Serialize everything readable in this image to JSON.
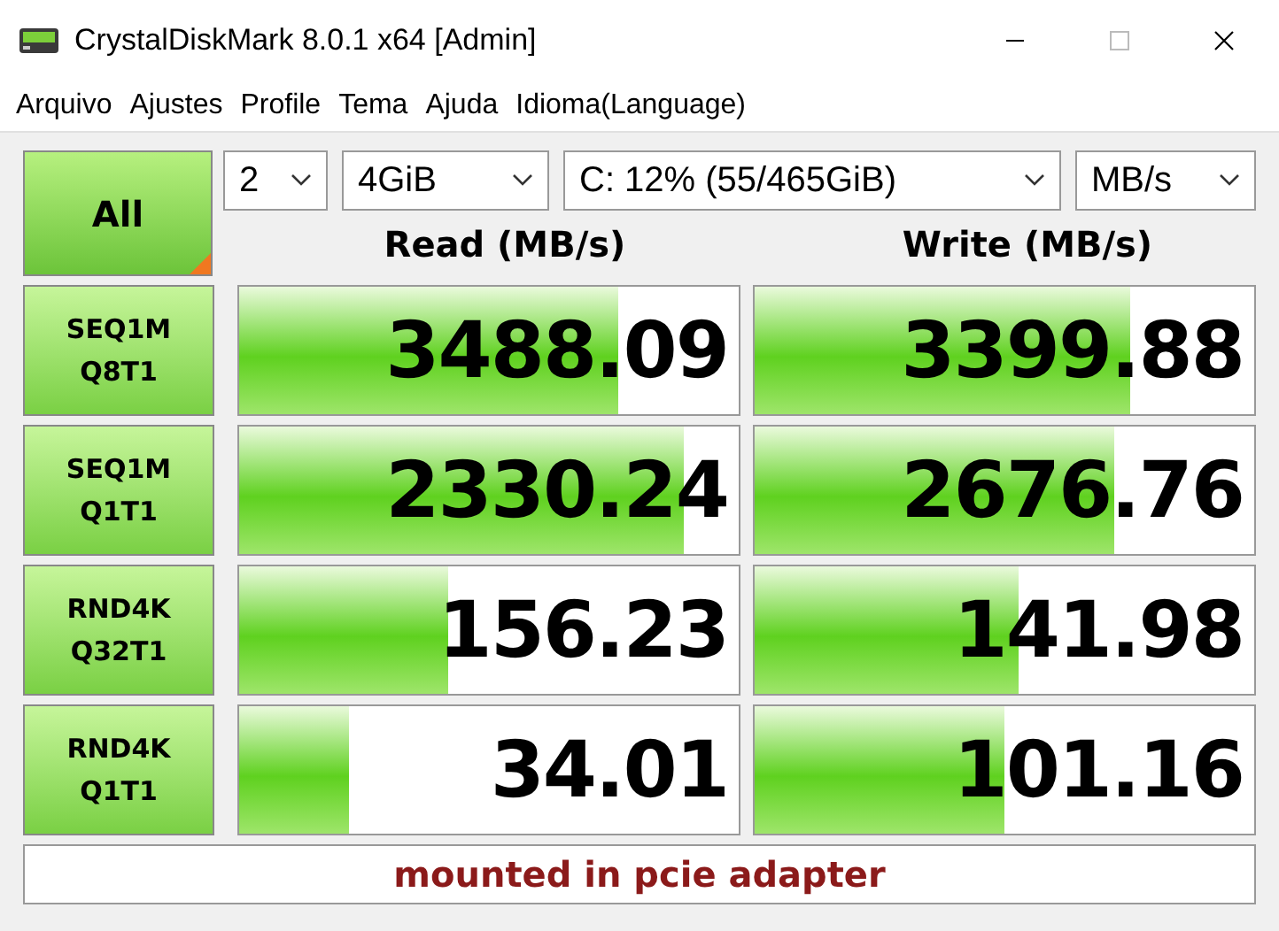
{
  "window": {
    "title": "CrystalDiskMark 8.0.1 x64 [Admin]"
  },
  "menu": [
    "Arquivo",
    "Ajustes",
    "Profile",
    "Tema",
    "Ajuda",
    "Idioma(Language)"
  ],
  "all_button": "All",
  "selectors": [
    {
      "value": "2"
    },
    {
      "value": "4GiB"
    },
    {
      "value": "C: 12% (55/465GiB)"
    },
    {
      "value": "MB/s"
    }
  ],
  "headers": {
    "read": "Read (MB/s)",
    "write": "Write (MB/s)"
  },
  "rows": [
    {
      "test": "SEQ1M",
      "params": "Q8T1",
      "read": {
        "value": "3488.09",
        "level": 0.76
      },
      "write": {
        "value": "3399.88",
        "level": 0.75
      }
    },
    {
      "test": "SEQ1M",
      "params": "Q1T1",
      "read": {
        "value": "2330.24",
        "level": 0.89
      },
      "write": {
        "value": "2676.76",
        "level": 0.72
      }
    },
    {
      "test": "RND4K",
      "params": "Q32T1",
      "read": {
        "value": "156.23",
        "level": 0.42
      },
      "write": {
        "value": "141.98",
        "level": 0.53
      }
    },
    {
      "test": "RND4K",
      "params": "Q1T1",
      "read": {
        "value": "34.01",
        "level": 0.22
      },
      "write": {
        "value": "101.16",
        "level": 0.5
      }
    }
  ],
  "comment": "mounted in pcie adapter"
}
